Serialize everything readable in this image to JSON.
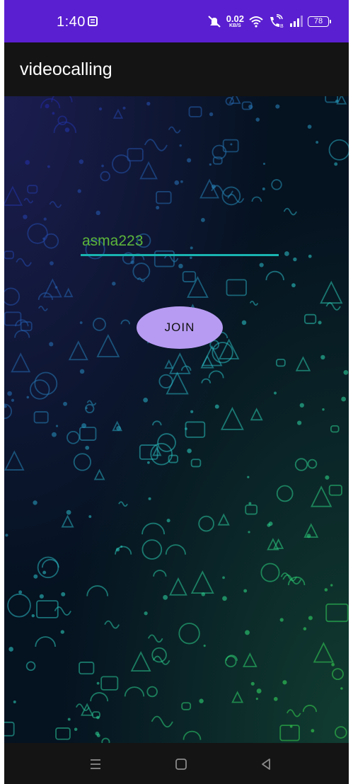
{
  "status_bar": {
    "time": "1:40",
    "net_speed_value": "0.02",
    "net_speed_unit": "KB/S",
    "battery": "78",
    "icons": [
      "notification-icon",
      "mute-icon",
      "wifi-icon",
      "wifi-calling-icon",
      "signal-icon",
      "battery-icon"
    ],
    "color": "#5a1fd0"
  },
  "app_bar": {
    "title": "videocalling",
    "color": "#141414"
  },
  "main": {
    "name_input": {
      "value": "asma223",
      "text_color": "#5cb53a",
      "underline_color": "#19b3b0"
    },
    "join_button": {
      "label": "JOIN",
      "color": "#b79bf2"
    }
  },
  "nav_bar": {
    "icons": [
      "recents-icon",
      "home-icon",
      "back-icon"
    ]
  }
}
